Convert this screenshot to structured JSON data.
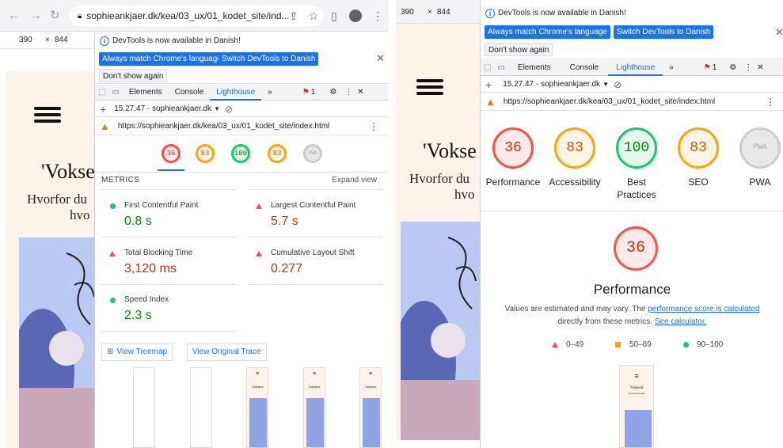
{
  "browser": {
    "url": "sophieankjaer.dk/kea/03_ux/01_kodet_site/ind...",
    "device_width": "390",
    "device_height": "844",
    "device_sep": "×"
  },
  "site": {
    "title_left": "'Vokse",
    "title_right": "'Vokse",
    "subtitle_left": "Hvorfor du",
    "subtitle_left2": "hvo",
    "subtitle_right": "Hvorfor du",
    "subtitle_right2": "hvo"
  },
  "devtools": {
    "info_text": "DevTools is now available in Danish!",
    "btn_match": "Always match Chrome's language",
    "btn_switch": "Switch DevTools to Danish",
    "btn_dont": "Don't show again",
    "tabs": [
      "Elements",
      "Console",
      "Lighthouse"
    ],
    "more_tabs": "»",
    "issues_count": "1",
    "session": "15.27.47 - sophieankjaer.dk",
    "report_url": "https://sophieankjaer.dk/kea/03_ux/01_kodet_site/index.html"
  },
  "scores": {
    "performance": "36",
    "accessibility": "83",
    "best_practices": "100",
    "seo": "83",
    "pwa": "PWA"
  },
  "categories": {
    "performance": "Performance",
    "accessibility": "Accessibility",
    "best_practices_1": "Best",
    "best_practices_2": "Practices",
    "seo": "SEO",
    "pwa": "PWA"
  },
  "metrics": {
    "header": "METRICS",
    "expand": "Expand view",
    "fcp_label": "First Contentful Paint",
    "fcp_value": "0.8 s",
    "lcp_label": "Largest Contentful Paint",
    "lcp_value": "5.7 s",
    "tbt_label": "Total Blocking Time",
    "tbt_value": "3,120 ms",
    "cls_label": "Cumulative Layout Shift",
    "cls_value": "0.277",
    "si_label": "Speed Index",
    "si_value": "2.3 s",
    "treemap_btn": "View Treemap",
    "trace_btn": "View Original Trace"
  },
  "perf_detail": {
    "score": "36",
    "title": "Performance",
    "note_1": "Values are estimated and may vary. The ",
    "note_link_1": "performance score is calculated",
    "note_2": "directly from these metrics. ",
    "note_link_2": "See calculator.",
    "legend_red": "0–49",
    "legend_orange": "50–89",
    "legend_green": "90–100"
  },
  "thumb_text": {
    "title": "'Voksenl",
    "line": "Hvorfor du skal"
  },
  "colors": {
    "accent": "#1a73e8",
    "fail": "#ff4e42",
    "average": "#ffa400",
    "pass": "#0cce6b"
  }
}
